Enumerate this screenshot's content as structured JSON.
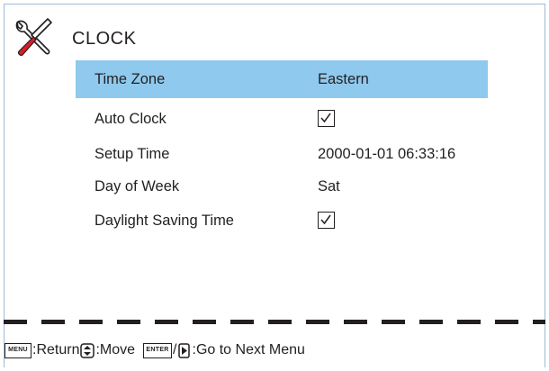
{
  "menu": {
    "title": "CLOCK",
    "icon": "tools-icon"
  },
  "items": [
    {
      "label": "Time Zone",
      "value": "Eastern",
      "selected": true
    },
    {
      "label": "Auto Clock",
      "checked": true
    },
    {
      "label": "Setup Time",
      "value": "2000-01-01 06:33:16"
    },
    {
      "label": "Day of Week",
      "value": "Sat"
    },
    {
      "label": "Daylight Saving Time",
      "checked": true
    }
  ],
  "footer": {
    "menu_key": "MENU",
    "return_text": ":Return",
    "move_text": ":Move",
    "enter_key": "ENTER",
    "slash": "/",
    "next_text": ":Go to Next Menu"
  },
  "colors": {
    "highlight": "#8fc9ee",
    "frame_border": "#9fbbd6",
    "text": "#231f20",
    "screwdriver_red": "#d61f26"
  }
}
